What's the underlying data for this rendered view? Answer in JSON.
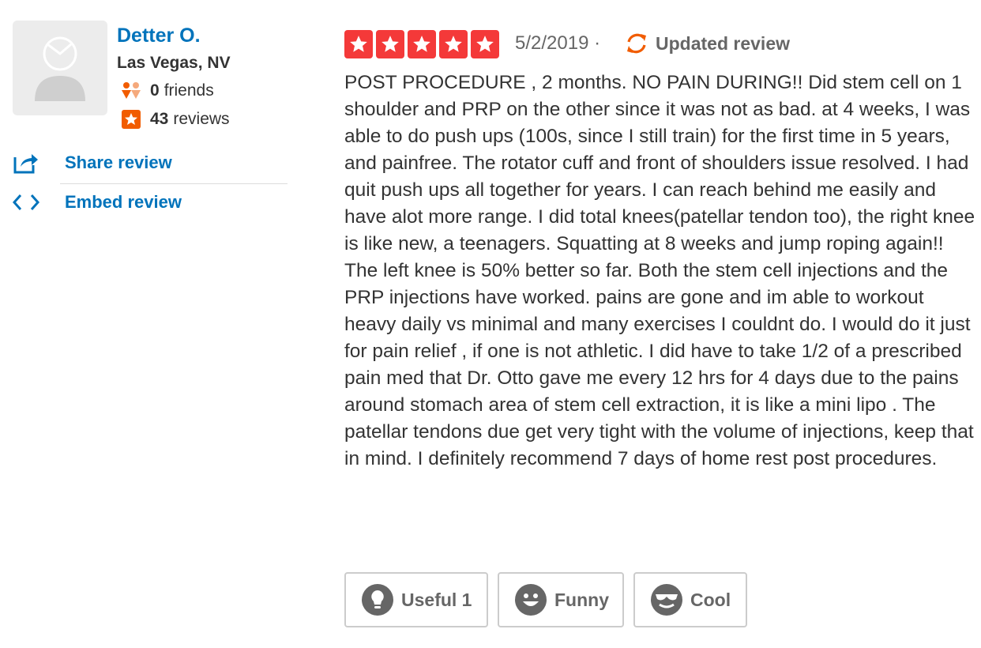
{
  "user": {
    "name": "Detter O.",
    "location": "Las Vegas, NV",
    "friends_count": "0",
    "friends_label": "friends",
    "reviews_count": "43",
    "reviews_label": "reviews"
  },
  "actions": {
    "share_label": "Share review",
    "embed_label": "Embed review"
  },
  "review": {
    "rating": 5,
    "date": "5/2/2019",
    "date_separator": "·",
    "updated_label": "Updated review",
    "text": "POST PROCEDURE , 2 months. NO PAIN DURING!! Did stem cell on 1 shoulder and PRP on the other since it was not as bad. at 4 weeks, I was able to do push ups (100s, since I still train) for the first time in 5 years, and painfree. The rotator cuff and front of shoulders issue resolved. I had quit push ups all together for years. I can reach behind me easily and have alot more range. I did total knees(patellar tendon too), the right knee is like new, a teenagers. Squatting at 8 weeks and jump roping again!! The left knee is 50% better so far. Both the stem cell injections and the PRP injections have worked. pains are gone and im able to workout heavy daily vs minimal and many exercises I couldnt do. I would do it just for pain relief , if one is not athletic. I did have to take 1/2 of a prescribed pain med that Dr. Otto gave me every 12 hrs for 4 days due to the pains around stomach area of stem cell extraction, it is like a mini lipo . The patellar tendons due get very tight with the volume of injections, keep that in mind. I definitely recommend 7 days of home rest post procedures."
  },
  "votes": {
    "useful_label": "Useful 1",
    "funny_label": "Funny",
    "cool_label": "Cool"
  },
  "colors": {
    "link": "#0073bb",
    "star": "#f43939",
    "updated_icon": "#f15c00",
    "friends_icon": "#f15c00",
    "reviews_icon": "#f15c00",
    "vote_icon": "#666666"
  },
  "icons": {
    "avatar": "default-user-avatar",
    "friends": "friends-icon",
    "reviews": "star-badge-icon",
    "share": "share-icon",
    "embed": "embed-code-icon",
    "star": "star-icon",
    "updated": "refresh-icon",
    "useful": "lightbulb-icon",
    "funny": "smiley-icon",
    "cool": "sunglasses-smiley-icon"
  }
}
